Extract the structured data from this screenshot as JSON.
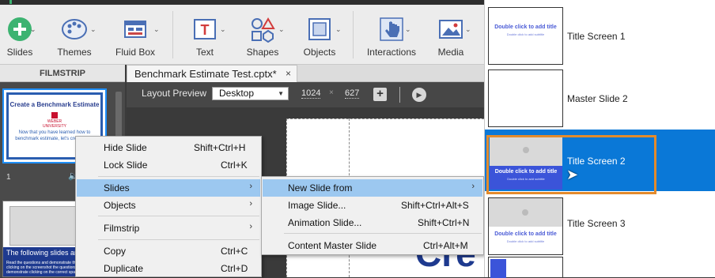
{
  "toolbar": {
    "buttons": [
      {
        "label": "Slides",
        "icon": "plus-circle-icon"
      },
      {
        "label": "Themes",
        "icon": "palette-icon"
      },
      {
        "label": "Fluid Box",
        "icon": "fluid-box-icon"
      },
      {
        "label": "Text",
        "icon": "text-icon"
      },
      {
        "label": "Shapes",
        "icon": "shapes-icon"
      },
      {
        "label": "Objects",
        "icon": "objects-icon"
      },
      {
        "label": "Interactions",
        "icon": "hand-pointer-icon"
      },
      {
        "label": "Media",
        "icon": "media-image-icon"
      }
    ]
  },
  "filmstrip": {
    "header": "FILMSTRIP",
    "slide1": {
      "title": "Create a Benchmark Estimate",
      "university": "WEBER\nUNIVERSITY",
      "body": "Now that you have learned how to\nbenchmark estimate, let's create one!",
      "number": "1"
    },
    "slide2": {
      "title": "The following slides are in",
      "body": "Read the questions and demonstrate the steps by clicking on the screenshot the questions and demonstrate clicking on the correct space on the s"
    }
  },
  "tab": {
    "label": "Benchmark Estimate Test.cptx*",
    "close": "×"
  },
  "layout_bar": {
    "label": "Layout Preview",
    "device": "Desktop",
    "width": "1024",
    "height": "627",
    "times": "×"
  },
  "canvas": {
    "big_text": "Cre"
  },
  "context_menu": {
    "items": [
      {
        "label": "Hide Slide",
        "shortcut": "Shift+Ctrl+H"
      },
      {
        "label": "Lock Slide",
        "shortcut": "Ctrl+K"
      },
      {
        "label": "Slides",
        "shortcut": ""
      },
      {
        "label": "Objects",
        "shortcut": ""
      },
      {
        "label": "Filmstrip",
        "shortcut": ""
      },
      {
        "label": "Copy",
        "shortcut": "Ctrl+C"
      },
      {
        "label": "Duplicate",
        "shortcut": "Ctrl+D"
      }
    ]
  },
  "submenu": {
    "items": [
      {
        "label": "New Slide from",
        "shortcut": ""
      },
      {
        "label": "Image Slide...",
        "shortcut": "Shift+Ctrl+Alt+S"
      },
      {
        "label": "Animation Slide...",
        "shortcut": "Shift+Ctrl+N"
      },
      {
        "label": "Content Master Slide",
        "shortcut": "Ctrl+Alt+M"
      }
    ]
  },
  "master_panel": {
    "thumb_title": "Double click to add title",
    "thumb_subtitle": "Double click to add subtitle",
    "items": [
      {
        "label": "Title Screen 1"
      },
      {
        "label": "Master Slide 2"
      },
      {
        "label": "Title Screen 2"
      },
      {
        "label": "Title Screen 3"
      }
    ]
  },
  "colors": {
    "selection": "#0a78d7",
    "highlight_outline": "#e38b2c",
    "menu_hover": "#9cc8f0"
  }
}
